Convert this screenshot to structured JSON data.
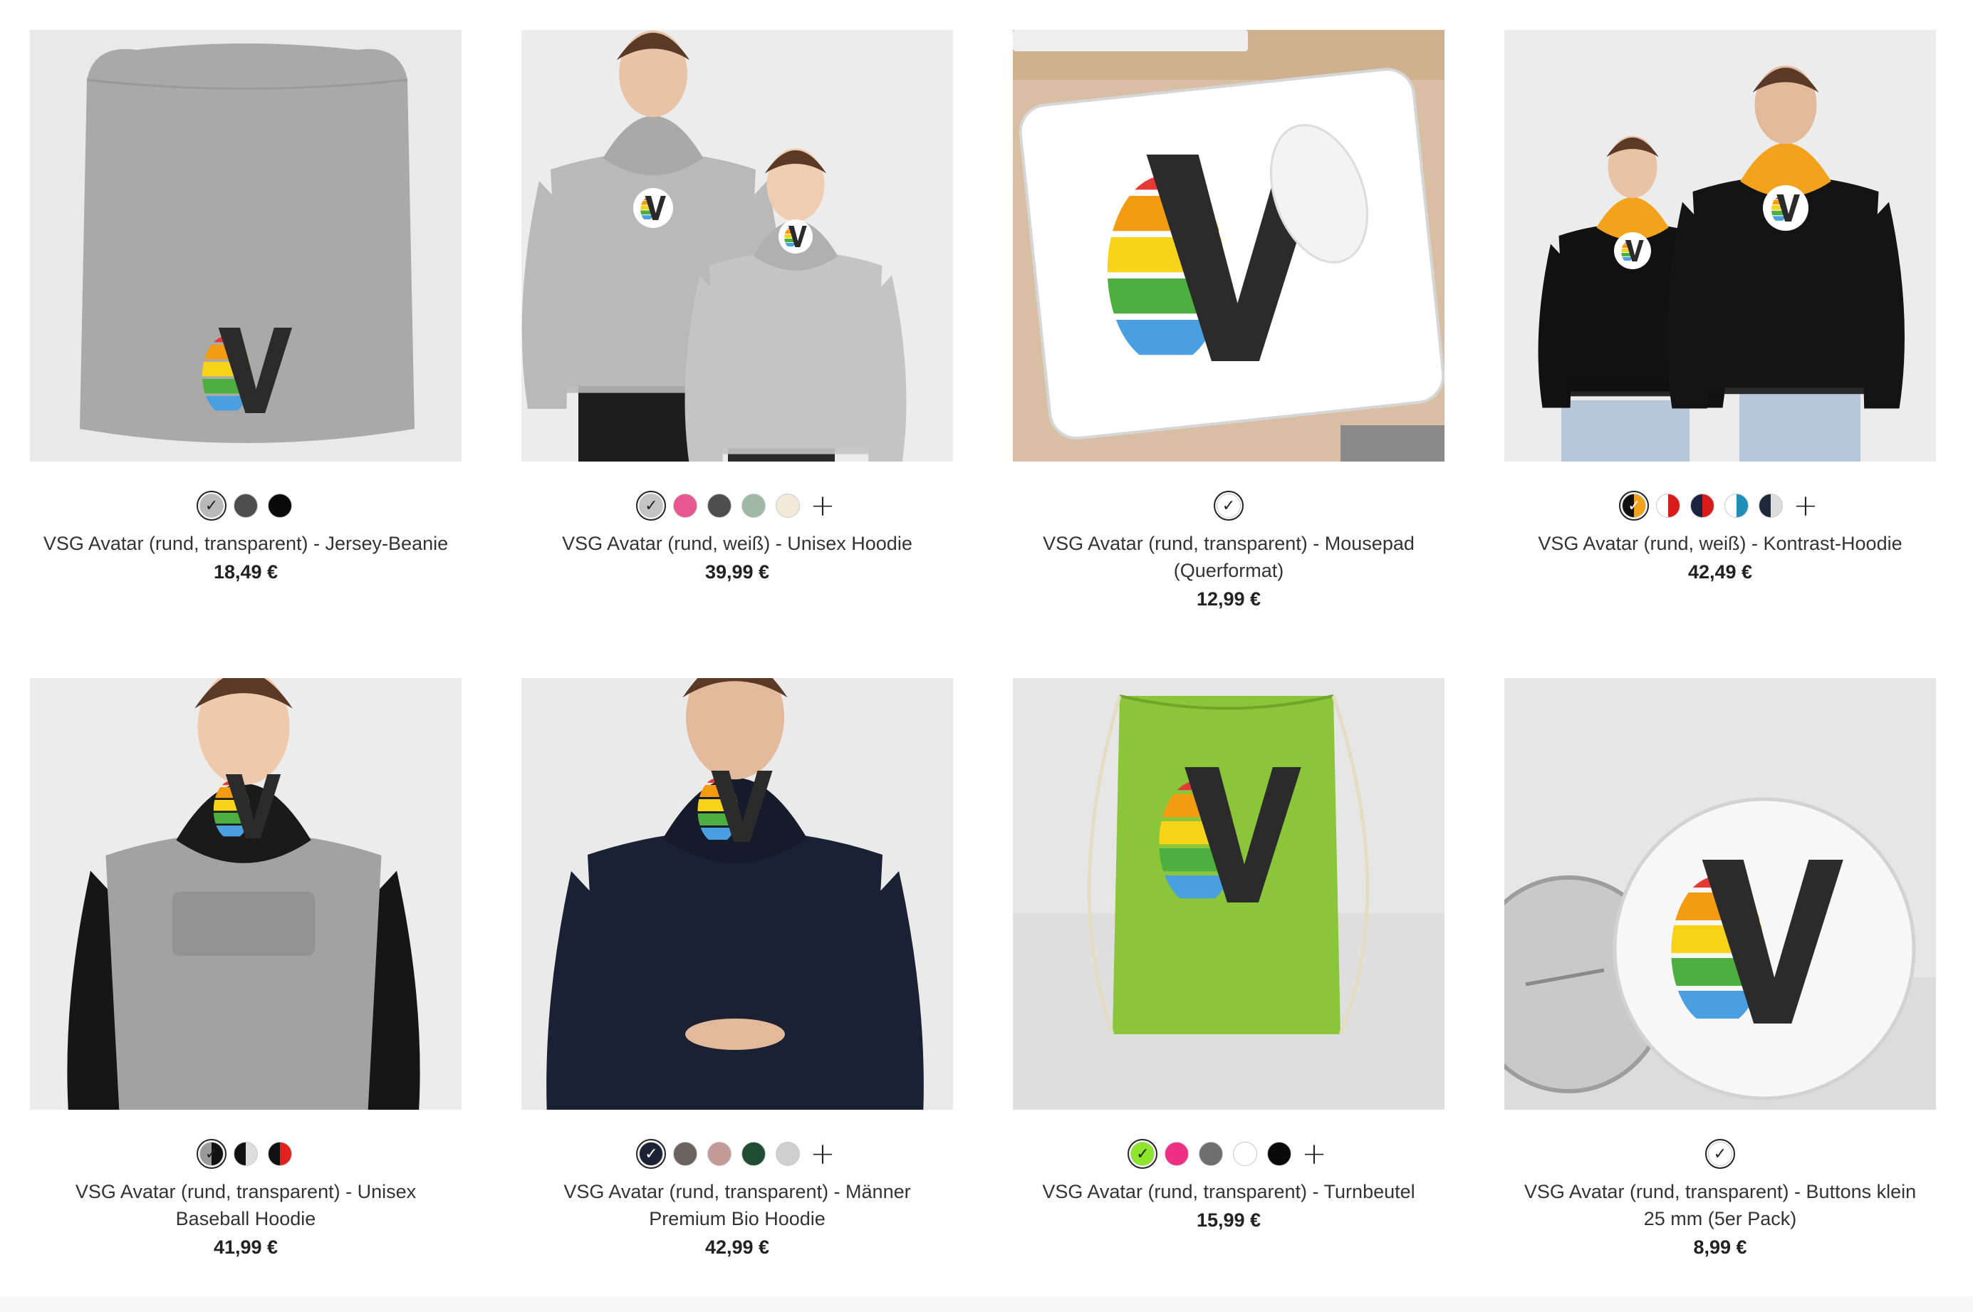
{
  "products": [
    {
      "title": "VSG Avatar (rund, transparent) - Jersey-Beanie",
      "price": "18,49 €",
      "image": "grey beanie with rainbow V logo",
      "swatches": [
        {
          "color": "#b9b9b9",
          "selected": true,
          "split": null
        },
        {
          "color": "#4e4e4e",
          "selected": false,
          "split": null
        },
        {
          "color": "#0a0a0a",
          "selected": false,
          "split": null
        }
      ],
      "more_colors": false
    },
    {
      "title": "VSG Avatar (rund, weiß) - Unisex Hoodie",
      "price": "39,99 €",
      "image": "two models in grey hoodies",
      "swatches": [
        {
          "color": "#c4c4c4",
          "selected": true,
          "split": null
        },
        {
          "color": "#e8578f",
          "selected": false,
          "split": null
        },
        {
          "color": "#4e4e4e",
          "selected": false,
          "split": null
        },
        {
          "color": "#9fb8a6",
          "selected": false,
          "split": null
        },
        {
          "color": "#f1ead8",
          "selected": false,
          "split": null
        }
      ],
      "more_colors": true
    },
    {
      "title": "VSG Avatar (rund, transparent) - Mousepad (Querformat)",
      "price": "12,99 €",
      "image": "white mousepad with mouse",
      "swatches": [
        {
          "color": "#ffffff",
          "selected": true,
          "split": null
        }
      ],
      "more_colors": false
    },
    {
      "title": "VSG Avatar (rund, weiß) - Kontrast-Hoodie",
      "price": "42,49 €",
      "image": "two models in black hoodies with orange hood",
      "swatches": [
        {
          "color": "#111111",
          "selected": true,
          "split": "#f2a21b"
        },
        {
          "color": "#ffffff",
          "selected": false,
          "split": "#d81c1c"
        },
        {
          "color": "#1a2340",
          "selected": false,
          "split": "#d81c1c"
        },
        {
          "color": "#ffffff",
          "selected": false,
          "split": "#1f8fb8"
        },
        {
          "color": "#1d2a3a",
          "selected": false,
          "split": "#dddddd"
        }
      ],
      "more_colors": true
    },
    {
      "title": "VSG Avatar (rund, transparent) - Unisex Baseball Hoodie",
      "price": "41,99 €",
      "image": "woman in grey raglan hoodie with black sleeves",
      "swatches": [
        {
          "color": "#9a9a9a",
          "selected": true,
          "split": "#111111"
        },
        {
          "color": "#111111",
          "selected": false,
          "split": "#dddddd"
        },
        {
          "color": "#111111",
          "selected": false,
          "split": "#e32020"
        }
      ],
      "more_colors": false
    },
    {
      "title": "VSG Avatar (rund, transparent) - Männer Premium Bio Hoodie",
      "price": "42,99 €",
      "image": "man in navy hoodie",
      "swatches": [
        {
          "color": "#1b2234",
          "selected": true,
          "split": null
        },
        {
          "color": "#6a625f",
          "selected": false,
          "split": null
        },
        {
          "color": "#c49a98",
          "selected": false,
          "split": null
        },
        {
          "color": "#1e4d31",
          "selected": false,
          "split": null
        },
        {
          "color": "#cfcfcf",
          "selected": false,
          "split": null
        }
      ],
      "more_colors": true
    },
    {
      "title": "VSG Avatar (rund, transparent) - Turnbeutel",
      "price": "15,99 €",
      "image": "green drawstring bag",
      "swatches": [
        {
          "color": "#8ee62a",
          "selected": true,
          "split": null
        },
        {
          "color": "#ee2f84",
          "selected": false,
          "split": null
        },
        {
          "color": "#6e6e6e",
          "selected": false,
          "split": null
        },
        {
          "color": "#ffffff",
          "selected": false,
          "split": null
        },
        {
          "color": "#0a0a0a",
          "selected": false,
          "split": null
        }
      ],
      "more_colors": true
    },
    {
      "title": "VSG Avatar (rund, transparent) - Buttons klein 25 mm (5er Pack)",
      "price": "8,99 €",
      "image": "two round pin buttons",
      "swatches": [
        {
          "color": "#ffffff",
          "selected": true,
          "split": null
        }
      ],
      "more_colors": false
    }
  ],
  "icons": {
    "check": "check-icon",
    "plus": "plus-icon"
  },
  "colors": {
    "rainbow": [
      "#e53935",
      "#f39c12",
      "#f7d31a",
      "#4caf3f",
      "#4a9fe0"
    ],
    "logo_dark": "#2b2b2b"
  }
}
